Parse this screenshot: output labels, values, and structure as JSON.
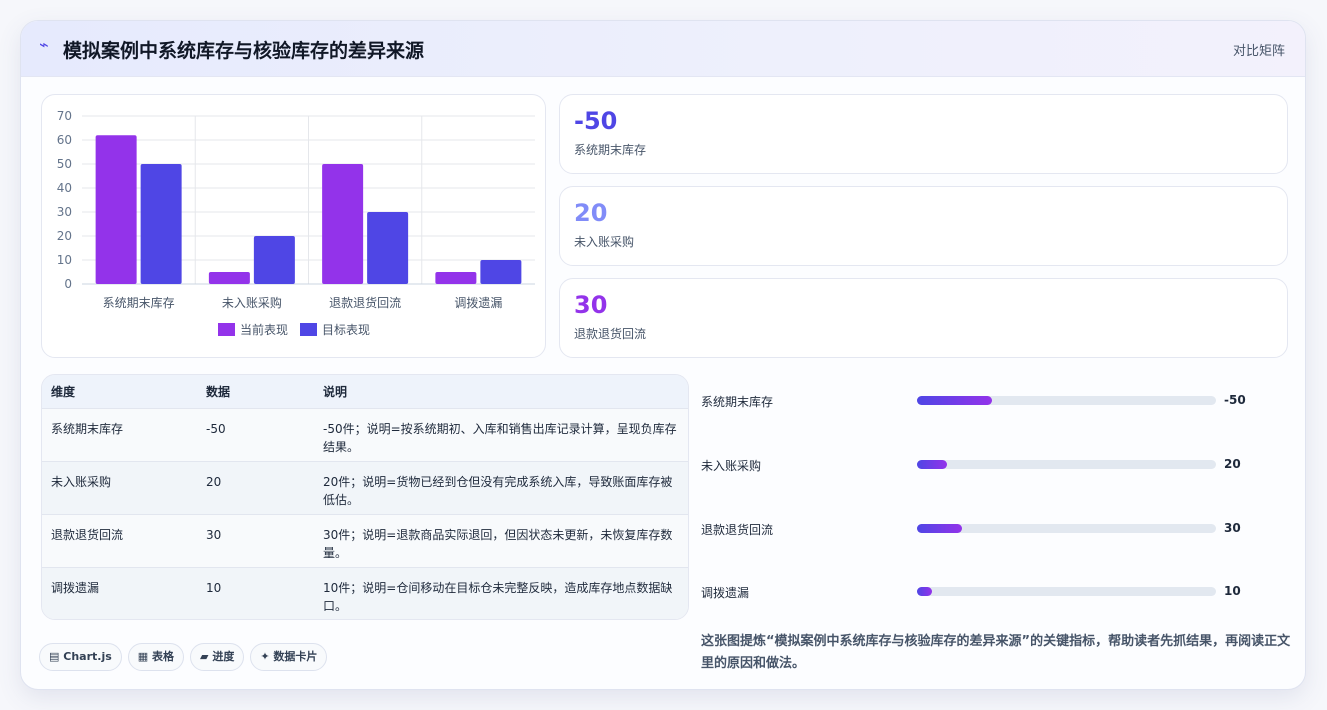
{
  "header": {
    "icon": "sparkle-icon",
    "title": "模拟案例中系统库存与核验库存的差异来源",
    "badge": "对比矩阵"
  },
  "chart_data": {
    "type": "bar",
    "categories": [
      "系统期末库存",
      "未入账采购",
      "退款退货回流",
      "调拨遗漏"
    ],
    "series": [
      {
        "name": "当前表现",
        "values": [
          62,
          5,
          50,
          5
        ],
        "color": "#9333ea"
      },
      {
        "name": "目标表现",
        "values": [
          50,
          20,
          30,
          10
        ],
        "color": "#4f46e5"
      }
    ],
    "yticks": [
      "0",
      "10",
      "20",
      "30",
      "40",
      "50",
      "60",
      "70"
    ],
    "ylim": [
      0,
      70
    ],
    "legend": "bottom",
    "grid": true
  },
  "stats": [
    {
      "value": "-50",
      "label": "系统期末库存",
      "color": "#4f46e5"
    },
    {
      "value": "20",
      "label": "未入账采购",
      "color": "#818cf8"
    },
    {
      "value": "30",
      "label": "退款退货回流",
      "color": "#9333ea"
    }
  ],
  "table": {
    "headers": [
      "维度",
      "数据",
      "说明"
    ],
    "rows": [
      [
        "系统期末库存",
        "-50",
        "-50件；说明=按系统期初、入库和销售出库记录计算，呈现负库存结果。"
      ],
      [
        "未入账采购",
        "20",
        "20件；说明=货物已经到仓但没有完成系统入库，导致账面库存被低估。"
      ],
      [
        "退款退货回流",
        "30",
        "30件；说明=退款商品实际退回，但因状态未更新，未恢复库存数量。"
      ],
      [
        "调拨遗漏",
        "10",
        "10件；说明=仓间移动在目标仓未完整反映，造成库存地点数据缺口。"
      ]
    ]
  },
  "progress": [
    {
      "label": "系统期末库存",
      "value": "-50",
      "fraction": 0.25
    },
    {
      "label": "未入账采购",
      "value": "20",
      "fraction": 0.1
    },
    {
      "label": "退款退货回流",
      "value": "30",
      "fraction": 0.15
    },
    {
      "label": "调拨遗漏",
      "value": "10",
      "fraction": 0.05
    }
  ],
  "chips": [
    {
      "icon": "chart-icon",
      "glyph": "▤",
      "label": "Chart.js"
    },
    {
      "icon": "table-icon",
      "glyph": "▦",
      "label": "表格"
    },
    {
      "icon": "progress-icon",
      "glyph": "▰",
      "label": "进度"
    },
    {
      "icon": "sparkle-icon",
      "glyph": "✦",
      "label": "数据卡片"
    }
  ],
  "summary": "这张图提炼“模拟案例中系统库存与核验库存的差异来源”的关键指标，帮助读者先抓结果，再阅读正文里的原因和做法。"
}
